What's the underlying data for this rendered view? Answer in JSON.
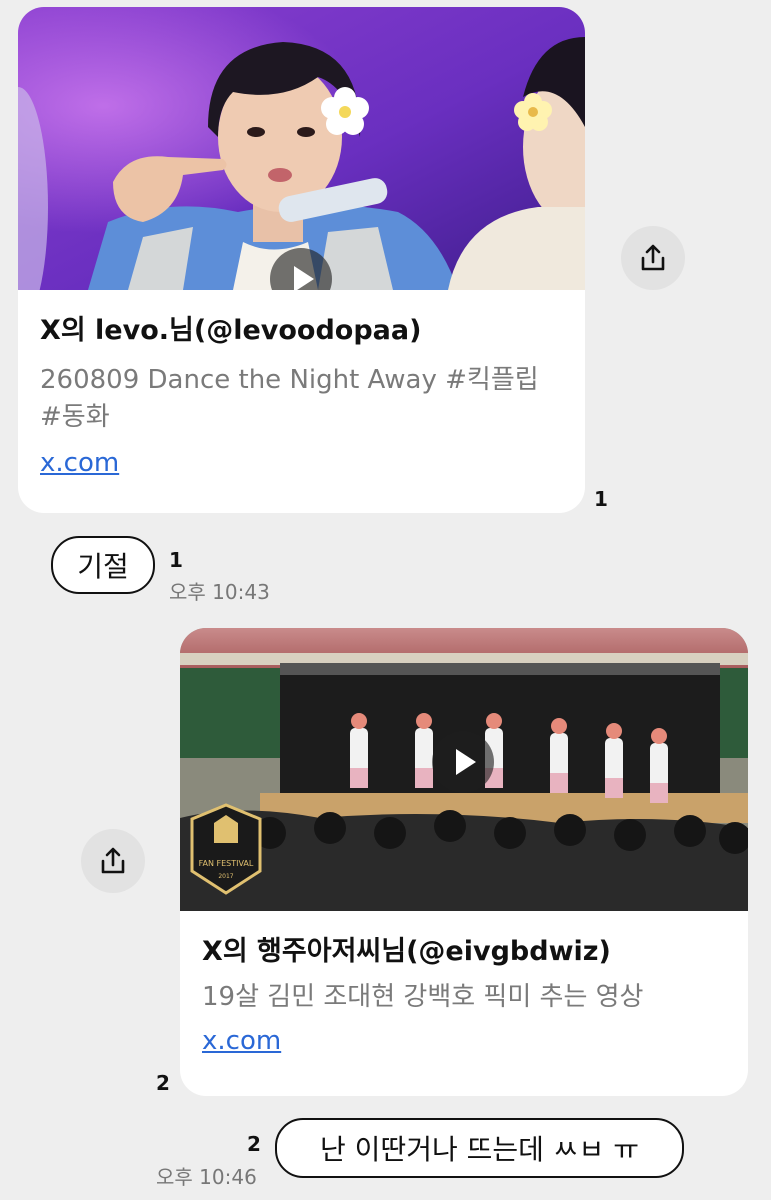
{
  "messages": [
    {
      "type": "link_preview",
      "card": {
        "title": "X의 levo.님(@levoodopaa)",
        "description": "260809 Dance the Night Away #킥플립 #동화",
        "link": "x.com",
        "image": "concert-photo-performer-with-flower-hairpin"
      },
      "unread_count": "1"
    },
    {
      "type": "text",
      "text": "기절",
      "unread_count": "1",
      "time": "오후 10:43"
    },
    {
      "type": "link_preview",
      "card": {
        "title": "X의 행주아저씨님(@eivgbdwiz)",
        "description": "19살 김민 조대현 강백호 픽미 추는 영상",
        "link": "x.com",
        "image": "fan-festival-stage-performance",
        "logo_text": "FAN FESTIVAL",
        "logo_year": "2017"
      },
      "unread_count": "2"
    },
    {
      "type": "text",
      "text": "난 이딴거나 뜨는데 ㅆㅂ ㅠ",
      "unread_count": "2",
      "time": "오후 10:46"
    }
  ],
  "icons": {
    "share": "share-icon",
    "play": "play-icon"
  },
  "colors": {
    "background": "#eeeeee",
    "card": "#ffffff",
    "link": "#2a68d6",
    "share_button": "#e2e2e2"
  }
}
